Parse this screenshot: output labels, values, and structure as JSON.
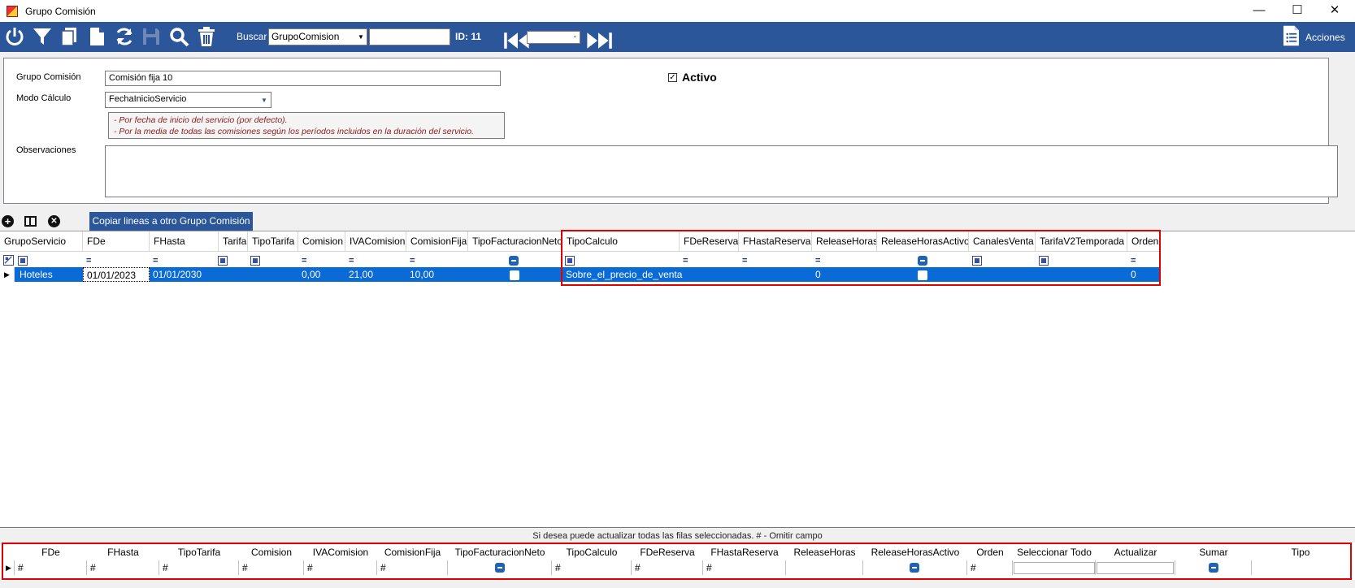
{
  "window": {
    "title": "Grupo Comisión",
    "minimize": "—",
    "maximize": "☐",
    "close": "✕"
  },
  "toolbar": {
    "search_label": "Buscar",
    "search_combo": "GrupoComision",
    "search_text": "",
    "id_label": "ID: 11",
    "nav_text": "",
    "acciones_label": "Acciones"
  },
  "form": {
    "grupo_label": "Grupo Comisión",
    "grupo_value": "Comisión fija 10",
    "modo_label": "Modo Cálculo",
    "modo_value": "FechaInicioServicio",
    "note_line1": "- Por fecha de inicio del servicio (por defecto).",
    "note_line2": "- Por la media de todas las comisiones según los períodos incluidos en la duración del servicio.",
    "observ_label": "Observaciones",
    "observ_value": "",
    "activo_label": "Activo",
    "activo_checked": true
  },
  "grid_toolbar": {
    "copy_button": "Copiar lineas a otro Grupo Comisión"
  },
  "grid": {
    "columns": [
      "GrupoServicio",
      "FDe",
      "FHasta",
      "Tarifa",
      "TipoTarifa",
      "Comision",
      "IVAComision",
      "ComisionFija",
      "TipoFacturacionNeto",
      "TipoCalculo",
      "FDeReserva",
      "FHastaReserva",
      "ReleaseHoras",
      "ReleaseHorasActivo",
      "CanalesVenta",
      "TarifaV2Temporada",
      "Orden"
    ],
    "filter_eq": "=",
    "row": {
      "GrupoServicio": "Hoteles",
      "FDe": "01/01/2023",
      "FHasta": "01/01/2030",
      "Comision": "0,00",
      "IVAComision": "21,00",
      "ComisionFija": "10,00",
      "TipoCalculo": "Sobre_el_precio_de_venta",
      "ReleaseHoras": "0",
      "Orden": "0"
    }
  },
  "bulk": {
    "message": "Si desea puede actualizar todas las filas seleccionadas. # - Omitir campo",
    "columns": [
      "FDe",
      "FHasta",
      "TipoTarifa",
      "Comision",
      "IVAComision",
      "ComisionFija",
      "TipoFacturacionNeto",
      "TipoCalculo",
      "FDeReserva",
      "FHastaReserva",
      "ReleaseHoras",
      "ReleaseHorasActivo",
      "Orden",
      "Seleccionar Todo",
      "Actualizar",
      "Sumar",
      "Tipo"
    ],
    "hash": "#"
  },
  "colors": {
    "toolbar": "#2b569a",
    "selection": "#0a6ad6",
    "highlight": "#e00000",
    "note_text": "#8b1a1a"
  }
}
